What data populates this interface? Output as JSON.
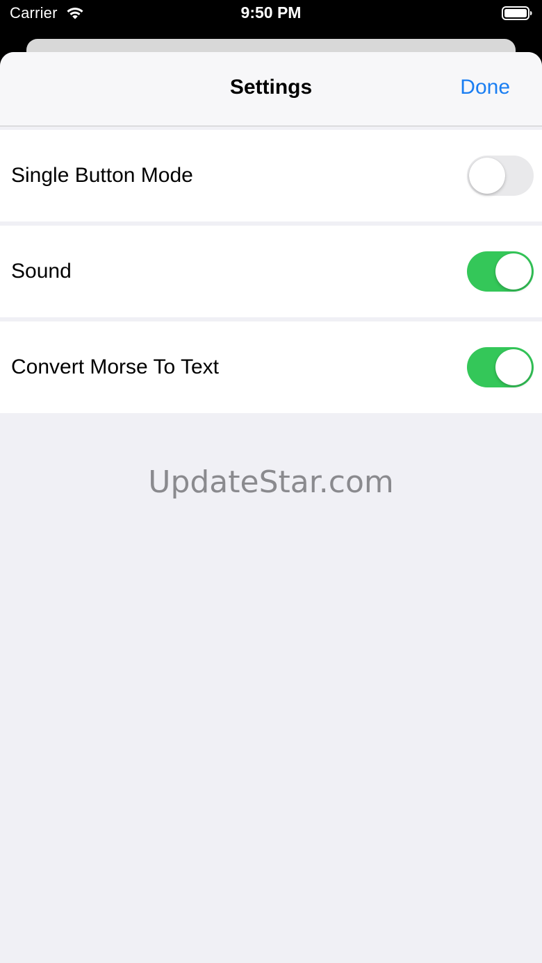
{
  "status_bar": {
    "carrier": "Carrier",
    "time": "9:50 PM",
    "wifi_icon": "wifi-icon",
    "battery_icon": "battery-full-icon"
  },
  "nav": {
    "title": "Settings",
    "done_label": "Done"
  },
  "settings": [
    {
      "label": "Single Button Mode",
      "enabled": false
    },
    {
      "label": "Sound",
      "enabled": true
    },
    {
      "label": "Convert Morse To Text",
      "enabled": true
    }
  ],
  "watermark": "UpdateStar.com",
  "colors": {
    "accent": "#1a7ef2",
    "toggle_on": "#34c759",
    "toggle_off": "#e9e9eb",
    "background": "#f0f0f5"
  }
}
